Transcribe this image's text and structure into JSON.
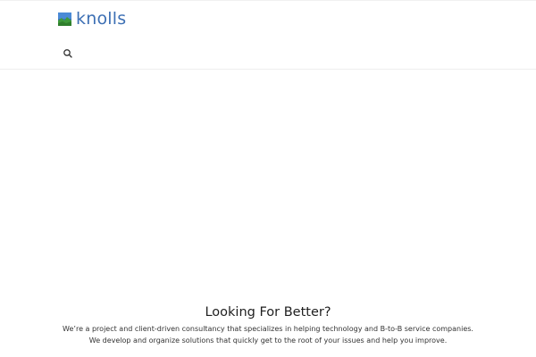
{
  "brand": {
    "name": "knolls",
    "logo_icon": "knolls-logo-icon",
    "color": "#3c6fb4"
  },
  "header": {
    "search_icon": "search-icon"
  },
  "intro": {
    "title": "Looking For Better?",
    "body": "We’re a project and client-driven consultancy that specializes in helping technology and B-to-B service companies. We develop and organize solutions that quickly get to the root of your issues and help you improve."
  }
}
